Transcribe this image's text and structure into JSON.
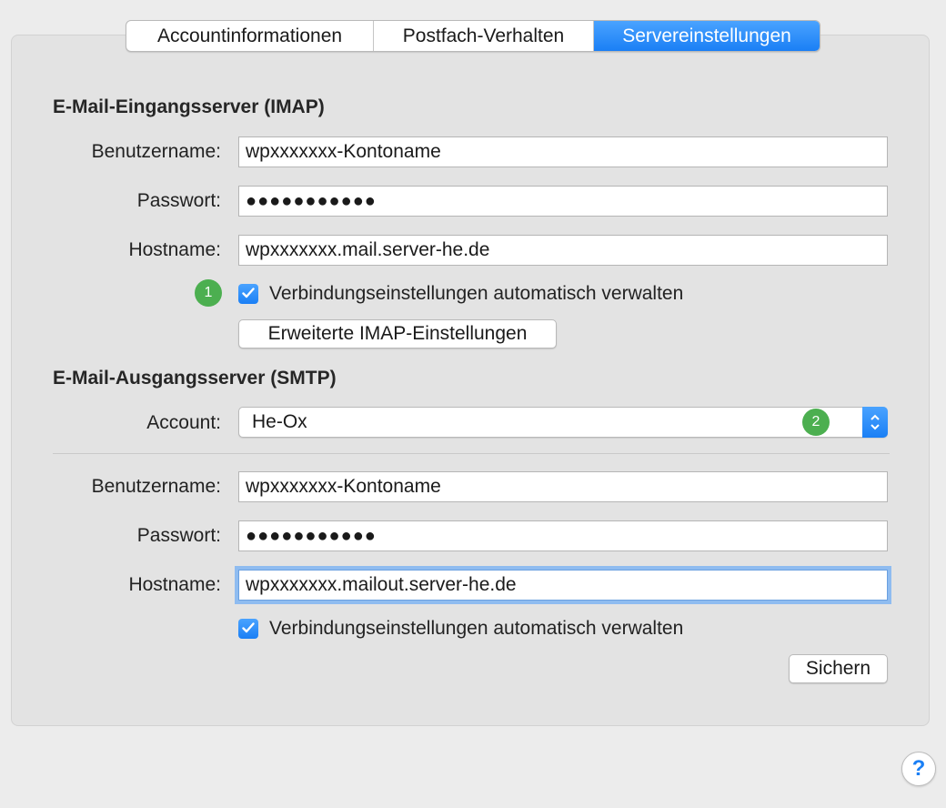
{
  "tabs": [
    {
      "label": "Accountinformationen",
      "active": false
    },
    {
      "label": "Postfach-Verhalten",
      "active": false
    },
    {
      "label": "Servereinstellungen",
      "active": true
    }
  ],
  "incoming": {
    "title": "E-Mail-Eingangsserver (IMAP)",
    "username_label": "Benutzername:",
    "username_value": "wpxxxxxxx-Kontoname",
    "password_label": "Passwort:",
    "password_value": "●●●●●●●●●●●",
    "hostname_label": "Hostname:",
    "hostname_value": "wpxxxxxxx.mail.server-he.de",
    "auto_manage_label": "Verbindungseinstellungen automatisch verwalten",
    "auto_manage_checked": true,
    "badge": "1",
    "advanced_button": "Erweiterte IMAP-Einstellungen"
  },
  "outgoing": {
    "title": "E-Mail-Ausgangsserver (SMTP)",
    "account_label": "Account:",
    "account_value": "He-Ox",
    "badge": "2",
    "username_label": "Benutzername:",
    "username_value": "wpxxxxxxx-Kontoname",
    "password_label": "Passwort:",
    "password_value": "●●●●●●●●●●●",
    "hostname_label": "Hostname:",
    "hostname_value": "wpxxxxxxx.mailout.server-he.de",
    "auto_manage_label": "Verbindungseinstellungen automatisch verwalten",
    "auto_manage_checked": true
  },
  "save_button": "Sichern",
  "help_button": "?",
  "colors": {
    "accent": "#1a7ff5",
    "badge": "#4caf50"
  }
}
